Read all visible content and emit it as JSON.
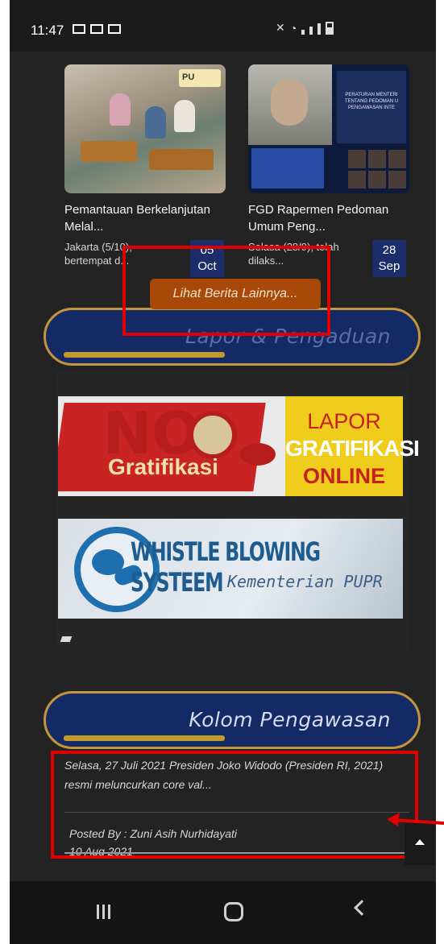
{
  "status_bar": {
    "time": "11:47"
  },
  "news": [
    {
      "title": "Pemantauan Berkelanjutan Melal...",
      "desc": "Jakarta (5/10), bertempat d...",
      "day": "05",
      "month": "Oct",
      "thumb_logo": "PU"
    },
    {
      "title": "FGD Rapermen Pedoman Umum Peng...",
      "desc": "Selasa (28/9), telah dilaks...",
      "day": "28",
      "month": "Sep",
      "thumb_doc": "PERATURAN MENTERI TENTANG PEDOMAN U PENGAWASAN INTE"
    }
  ],
  "more_news_label": "Lihat Berita Lainnya...",
  "section_lapor": "Lapor & Pengaduan",
  "banner_gratifikasi": {
    "no": "NO",
    "gratifikasi": "Gratifikasi",
    "lapor": "LAPOR",
    "gratifikasi_caps": "GRATIFIKASI",
    "online": "ONLINE"
  },
  "banner_whistle": {
    "title": "WHISTLE BLOWING SYSTEEM",
    "subtitle": "Kementerian PUPR"
  },
  "section_kolom": "Kolom Pengawasan",
  "article": {
    "excerpt": "Selasa, 27 Juli 2021 Presiden Joko Widodo (Presiden RI, 2021) resmi meluncurkan core val...",
    "posted_by": "Posted By : Zuni Asih Nurhidayati",
    "date": "10 Aug 2021"
  },
  "colors": {
    "highlight": "#e00000",
    "section_bg": "#142a66",
    "section_border": "#c3963b",
    "accent_gold": "#c19a2c",
    "button_orange": "#a8490a"
  }
}
